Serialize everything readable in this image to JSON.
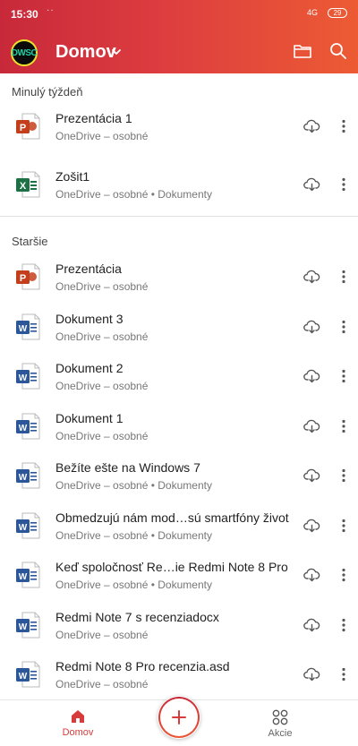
{
  "status": {
    "time": "15:30",
    "dots": "··",
    "signal": "4G",
    "battery": "29"
  },
  "header": {
    "avatar_text": "DWSC",
    "title": "Domov"
  },
  "sections": [
    {
      "label": "Minulý týždeň"
    },
    {
      "label": "Staršie"
    }
  ],
  "files": [
    {
      "type": "ppt",
      "title": "Prezentácia 1",
      "sub": "OneDrive – osobné"
    },
    {
      "type": "xls",
      "title": "Zošit1",
      "sub": "OneDrive – osobné • Dokumenty"
    },
    {
      "type": "ppt",
      "title": "Prezentácia",
      "sub": "OneDrive – osobné"
    },
    {
      "type": "doc",
      "title": "Dokument 3",
      "sub": "OneDrive – osobné"
    },
    {
      "type": "doc",
      "title": "Dokument 2",
      "sub": "OneDrive – osobné"
    },
    {
      "type": "doc",
      "title": "Dokument 1",
      "sub": "OneDrive – osobné"
    },
    {
      "type": "doc",
      "title": "Bežíte ešte na Windows 7",
      "sub": "OneDrive – osobné • Dokumenty"
    },
    {
      "type": "doc",
      "title": "Obmedzujú nám mod…sú smartfóny život",
      "sub": "OneDrive – osobné • Dokumenty"
    },
    {
      "type": "doc",
      "title": "Keď spoločnosť Re…ie Redmi Note 8 Pro",
      "sub": "OneDrive – osobné • Dokumenty"
    },
    {
      "type": "doc",
      "title": "Redmi Note 7 s recenziadocx",
      "sub": "OneDrive – osobné"
    },
    {
      "type": "doc",
      "title": "Redmi Note 8 Pro recenzia.asd",
      "sub": "OneDrive – osobné"
    }
  ],
  "bottom_nav": {
    "home_label": "Domov",
    "actions_label": "Akcie"
  },
  "colors": {
    "accent": "#d83b3b",
    "ppt": "#c43e1c",
    "xls": "#1e7145",
    "doc": "#2b579a"
  }
}
